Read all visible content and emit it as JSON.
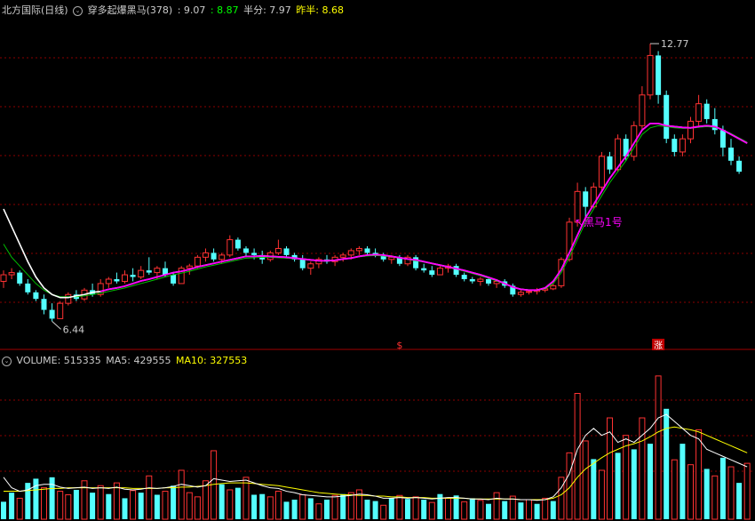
{
  "header": {
    "stock": "北方国际(日线)",
    "indicator_name": "穿多起爆黑马(378)",
    "value1": ": 9.07",
    "value2": ": 8.87",
    "half_label": "半分: 7.97",
    "prev_half_label": "昨半: 8.68"
  },
  "volume_header": {
    "volume": "VOLUME: 515335",
    "ma5": "MA5: 429555",
    "ma10": "MA10: 327553"
  },
  "colors": {
    "up": "#ff3232",
    "down": "#54ffff",
    "magenta": "#ff00ff",
    "white_line": "#ffffff",
    "green_line": "#00c000",
    "yellow": "#ffff00",
    "grid": "#8b0000",
    "header_green": "#00ff00"
  },
  "chart_data": {
    "type": "candlestick",
    "price_range": [
      5.9,
      13.4
    ],
    "volume_max": 215000,
    "annotations": {
      "high": "12.77",
      "low": "6.44",
      "signal": "黑马1号",
      "marker1": "$",
      "marker2": "涨"
    },
    "candles": [
      [
        7.35,
        7.6,
        7.2,
        7.5
      ],
      [
        7.5,
        7.65,
        7.4,
        7.55
      ],
      [
        7.55,
        7.6,
        7.25,
        7.3
      ],
      [
        7.3,
        7.4,
        7.05,
        7.1
      ],
      [
        7.1,
        7.15,
        6.9,
        6.95
      ],
      [
        6.95,
        7.05,
        6.6,
        6.7
      ],
      [
        6.7,
        6.85,
        6.44,
        6.5
      ],
      [
        6.5,
        6.9,
        6.5,
        6.85
      ],
      [
        6.85,
        7.1,
        6.8,
        7.05
      ],
      [
        7.05,
        7.15,
        6.9,
        6.95
      ],
      [
        6.95,
        7.2,
        6.9,
        7.15
      ],
      [
        7.15,
        7.3,
        7.0,
        7.05
      ],
      [
        7.05,
        7.4,
        7.0,
        7.3
      ],
      [
        7.3,
        7.45,
        7.2,
        7.4
      ],
      [
        7.4,
        7.55,
        7.3,
        7.35
      ],
      [
        7.35,
        7.6,
        7.3,
        7.5
      ],
      [
        7.5,
        7.65,
        7.35,
        7.45
      ],
      [
        7.45,
        7.7,
        7.4,
        7.6
      ],
      [
        7.6,
        7.9,
        7.5,
        7.55
      ],
      [
        7.55,
        7.7,
        7.4,
        7.65
      ],
      [
        7.65,
        7.8,
        7.45,
        7.5
      ],
      [
        7.5,
        7.55,
        7.25,
        7.3
      ],
      [
        7.3,
        7.7,
        7.3,
        7.65
      ],
      [
        7.65,
        7.75,
        7.5,
        7.7
      ],
      [
        7.7,
        7.95,
        7.65,
        7.9
      ],
      [
        7.9,
        8.1,
        7.8,
        8.0
      ],
      [
        8.0,
        8.1,
        7.8,
        7.85
      ],
      [
        7.85,
        8.0,
        7.75,
        7.95
      ],
      [
        7.95,
        8.4,
        7.9,
        8.3
      ],
      [
        8.3,
        8.35,
        8.05,
        8.1
      ],
      [
        8.1,
        8.15,
        7.9,
        8.0
      ],
      [
        8.0,
        8.1,
        7.85,
        7.95
      ],
      [
        7.95,
        8.05,
        7.75,
        7.85
      ],
      [
        7.85,
        8.05,
        7.8,
        8.0
      ],
      [
        8.0,
        8.3,
        7.95,
        8.1
      ],
      [
        8.1,
        8.15,
        7.9,
        7.95
      ],
      [
        7.95,
        8.0,
        7.8,
        7.85
      ],
      [
        7.85,
        7.95,
        7.6,
        7.65
      ],
      [
        7.65,
        7.8,
        7.5,
        7.75
      ],
      [
        7.75,
        7.9,
        7.65,
        7.85
      ],
      [
        7.85,
        7.95,
        7.75,
        7.8
      ],
      [
        7.8,
        7.95,
        7.7,
        7.9
      ],
      [
        7.9,
        8.0,
        7.8,
        7.95
      ],
      [
        7.95,
        8.1,
        7.85,
        8.05
      ],
      [
        8.05,
        8.15,
        7.95,
        8.1
      ],
      [
        8.1,
        8.15,
        7.95,
        8.0
      ],
      [
        8.0,
        8.1,
        7.9,
        7.95
      ],
      [
        7.95,
        8.0,
        7.8,
        7.85
      ],
      [
        7.85,
        7.95,
        7.75,
        7.9
      ],
      [
        7.9,
        7.95,
        7.7,
        7.75
      ],
      [
        7.75,
        7.95,
        7.7,
        7.9
      ],
      [
        7.9,
        7.95,
        7.6,
        7.65
      ],
      [
        7.65,
        7.75,
        7.55,
        7.6
      ],
      [
        7.6,
        7.7,
        7.45,
        7.5
      ],
      [
        7.5,
        7.7,
        7.5,
        7.65
      ],
      [
        7.65,
        7.75,
        7.55,
        7.7
      ],
      [
        7.7,
        7.75,
        7.45,
        7.5
      ],
      [
        7.5,
        7.55,
        7.35,
        7.4
      ],
      [
        7.4,
        7.45,
        7.3,
        7.35
      ],
      [
        7.35,
        7.45,
        7.25,
        7.4
      ],
      [
        7.4,
        7.45,
        7.25,
        7.3
      ],
      [
        7.3,
        7.4,
        7.2,
        7.35
      ],
      [
        7.35,
        7.4,
        7.2,
        7.25
      ],
      [
        7.25,
        7.3,
        7.0,
        7.05
      ],
      [
        7.05,
        7.15,
        7.0,
        7.1
      ],
      [
        7.1,
        7.15,
        7.05,
        7.12
      ],
      [
        7.12,
        7.2,
        7.05,
        7.15
      ],
      [
        7.15,
        7.2,
        7.1,
        7.18
      ],
      [
        7.18,
        7.3,
        7.15,
        7.25
      ],
      [
        7.25,
        7.9,
        7.2,
        7.85
      ],
      [
        7.85,
        8.8,
        7.8,
        8.7
      ],
      [
        8.7,
        9.6,
        8.6,
        9.4
      ],
      [
        9.4,
        9.5,
        8.8,
        9.05
      ],
      [
        9.05,
        9.6,
        9.0,
        9.5
      ],
      [
        9.5,
        10.3,
        9.4,
        10.2
      ],
      [
        10.2,
        10.3,
        9.8,
        9.9
      ],
      [
        9.9,
        10.7,
        9.85,
        10.6
      ],
      [
        10.6,
        10.7,
        10.1,
        10.2
      ],
      [
        10.2,
        11.0,
        10.1,
        10.9
      ],
      [
        10.9,
        11.8,
        10.8,
        11.6
      ],
      [
        11.6,
        12.77,
        11.5,
        12.5
      ],
      [
        12.5,
        12.6,
        11.4,
        11.6
      ],
      [
        11.6,
        11.7,
        10.5,
        10.6
      ],
      [
        10.6,
        10.7,
        10.2,
        10.3
      ],
      [
        10.3,
        10.7,
        10.2,
        10.6
      ],
      [
        10.6,
        11.1,
        10.5,
        11.0
      ],
      [
        11.0,
        11.6,
        10.9,
        11.4
      ],
      [
        11.4,
        11.5,
        10.95,
        11.05
      ],
      [
        11.05,
        11.3,
        10.7,
        10.8
      ],
      [
        10.8,
        10.9,
        10.2,
        10.4
      ],
      [
        10.4,
        10.6,
        10.0,
        10.1
      ],
      [
        10.1,
        10.2,
        9.8,
        9.85
      ]
    ],
    "volumes": [
      [
        25000,
        false
      ],
      [
        38000,
        false
      ],
      [
        30000,
        true
      ],
      [
        52000,
        false
      ],
      [
        58000,
        false
      ],
      [
        45000,
        true
      ],
      [
        60000,
        false
      ],
      [
        40000,
        true
      ],
      [
        35000,
        true
      ],
      [
        42000,
        false
      ],
      [
        55000,
        true
      ],
      [
        38000,
        false
      ],
      [
        48000,
        true
      ],
      [
        36000,
        false
      ],
      [
        52000,
        true
      ],
      [
        30000,
        false
      ],
      [
        41000,
        true
      ],
      [
        38000,
        false
      ],
      [
        62000,
        true
      ],
      [
        35000,
        false
      ],
      [
        40000,
        true
      ],
      [
        48000,
        false
      ],
      [
        70000,
        true
      ],
      [
        38000,
        true
      ],
      [
        32000,
        true
      ],
      [
        55000,
        true
      ],
      [
        98000,
        true
      ],
      [
        50000,
        false
      ],
      [
        42000,
        true
      ],
      [
        45000,
        false
      ],
      [
        60000,
        true
      ],
      [
        35000,
        false
      ],
      [
        36000,
        false
      ],
      [
        32000,
        true
      ],
      [
        40000,
        true
      ],
      [
        25000,
        false
      ],
      [
        28000,
        false
      ],
      [
        35000,
        true
      ],
      [
        30000,
        false
      ],
      [
        22000,
        true
      ],
      [
        28000,
        false
      ],
      [
        34000,
        true
      ],
      [
        36000,
        false
      ],
      [
        38000,
        true
      ],
      [
        42000,
        true
      ],
      [
        28000,
        false
      ],
      [
        26000,
        false
      ],
      [
        20000,
        true
      ],
      [
        30000,
        false
      ],
      [
        34000,
        true
      ],
      [
        29000,
        false
      ],
      [
        32000,
        true
      ],
      [
        28000,
        false
      ],
      [
        24000,
        true
      ],
      [
        36000,
        false
      ],
      [
        30000,
        true
      ],
      [
        34000,
        false
      ],
      [
        25000,
        true
      ],
      [
        30000,
        false
      ],
      [
        27000,
        true
      ],
      [
        22000,
        false
      ],
      [
        38000,
        true
      ],
      [
        26000,
        false
      ],
      [
        33000,
        true
      ],
      [
        24000,
        false
      ],
      [
        28000,
        true
      ],
      [
        22000,
        false
      ],
      [
        30000,
        true
      ],
      [
        26000,
        false
      ],
      [
        60000,
        true
      ],
      [
        95000,
        true
      ],
      [
        180000,
        true
      ],
      [
        112000,
        true
      ],
      [
        86000,
        false
      ],
      [
        70000,
        true
      ],
      [
        145000,
        true
      ],
      [
        95000,
        false
      ],
      [
        120000,
        true
      ],
      [
        100000,
        false
      ],
      [
        145000,
        true
      ],
      [
        108000,
        false
      ],
      [
        205000,
        true
      ],
      [
        158000,
        false
      ],
      [
        85000,
        true
      ],
      [
        108000,
        false
      ],
      [
        78000,
        true
      ],
      [
        128000,
        true
      ],
      [
        72000,
        false
      ],
      [
        62000,
        true
      ],
      [
        88000,
        false
      ],
      [
        75000,
        true
      ],
      [
        52000,
        false
      ],
      [
        80000,
        true
      ]
    ],
    "ma_white": [
      9.0,
      8.6,
      8.2,
      7.8,
      7.45,
      7.2,
      7.05,
      6.98,
      6.98,
      7.02,
      7.05,
      7.1,
      7.12,
      7.17,
      7.2,
      7.24,
      7.3,
      7.36,
      7.4,
      7.45,
      7.5,
      7.55,
      7.58,
      7.62,
      7.68,
      7.72,
      7.76,
      7.8,
      7.84,
      7.88,
      7.92,
      7.92,
      7.93,
      7.92,
      7.91,
      7.9,
      7.88,
      7.86,
      7.84,
      7.82,
      7.82,
      7.83,
      7.86,
      7.88,
      7.92,
      7.95,
      7.96,
      7.95,
      7.92,
      7.89,
      7.86,
      7.84,
      7.8,
      7.76,
      7.72,
      7.68,
      7.64,
      7.6,
      7.55,
      7.5,
      7.44,
      7.38,
      7.3,
      7.22,
      7.17,
      7.15,
      7.15,
      7.2,
      7.35,
      7.62,
      8.0,
      8.4,
      8.8,
      9.1,
      9.4,
      9.7,
      9.95,
      10.2,
      10.5,
      10.8,
      10.95,
      10.95,
      10.9,
      10.88,
      10.86,
      10.85,
      10.88,
      10.9,
      10.88,
      10.8,
      10.7,
      10.6,
      10.5
    ],
    "ma_green": [
      8.2,
      7.9,
      7.7,
      7.5,
      7.3,
      7.15,
      7.05,
      7.0,
      7.0,
      7.0,
      7.02,
      7.05,
      7.08,
      7.12,
      7.16,
      7.2,
      7.25,
      7.3,
      7.35,
      7.4,
      7.45,
      7.5,
      7.54,
      7.58,
      7.63,
      7.68,
      7.72,
      7.76,
      7.8,
      7.84,
      7.88,
      7.89,
      7.9,
      7.9,
      7.89,
      7.88,
      7.87,
      7.85,
      7.83,
      7.82,
      7.82,
      7.83,
      7.85,
      7.88,
      7.91,
      7.93,
      7.94,
      7.93,
      7.91,
      7.88,
      7.85,
      7.82,
      7.79,
      7.75,
      7.71,
      7.67,
      7.63,
      7.58,
      7.53,
      7.48,
      7.42,
      7.36,
      7.29,
      7.22,
      7.17,
      7.15,
      7.15,
      7.18,
      7.3,
      7.55,
      7.9,
      8.3,
      8.7,
      9.0,
      9.3,
      9.6,
      9.85,
      10.1,
      10.4,
      10.7,
      10.85,
      10.9,
      10.88,
      10.85,
      10.84,
      10.84,
      10.86,
      10.88,
      10.86,
      10.8,
      10.72,
      10.62,
      10.52
    ],
    "ma_magenta_from": 12,
    "vol_ma_white": [
      60000,
      45000,
      40000,
      42000,
      48000,
      50000,
      50000,
      46000,
      44000,
      45000,
      46000,
      44000,
      45000,
      44000,
      46000,
      43000,
      42000,
      43000,
      45000,
      44000,
      45000,
      47000,
      50000,
      48000,
      46000,
      48000,
      58000,
      56000,
      54000,
      55000,
      56000,
      52000,
      48000,
      45000,
      44000,
      40000,
      38000,
      35000,
      34000,
      33000,
      32000,
      32000,
      33000,
      34000,
      36000,
      35000,
      33000,
      30000,
      30000,
      31000,
      30000,
      31000,
      30000,
      29000,
      30000,
      31000,
      31000,
      30000,
      29000,
      29000,
      28000,
      30000,
      29000,
      29000,
      28000,
      28000,
      27000,
      28000,
      32000,
      45000,
      65000,
      100000,
      120000,
      130000,
      120000,
      125000,
      110000,
      115000,
      110000,
      120000,
      130000,
      145000,
      150000,
      140000,
      130000,
      120000,
      115000,
      100000,
      95000,
      90000,
      85000,
      80000,
      75000
    ],
    "vol_ma_yellow": [
      40000,
      40000,
      40000,
      41000,
      42000,
      43000,
      44000,
      44000,
      45000,
      45000,
      45000,
      45000,
      45000,
      45000,
      45000,
      45000,
      44000,
      44000,
      44000,
      44000,
      45000,
      45000,
      46000,
      46000,
      47000,
      48000,
      50000,
      51000,
      52000,
      52000,
      52000,
      51000,
      50000,
      49000,
      48000,
      46000,
      44000,
      42000,
      40000,
      38000,
      37000,
      36000,
      35000,
      35000,
      34000,
      34000,
      33000,
      33000,
      32000,
      32000,
      31000,
      31000,
      31000,
      30000,
      30000,
      30000,
      30000,
      30000,
      29000,
      29000,
      29000,
      29000,
      29000,
      29000,
      28000,
      28000,
      28000,
      28000,
      30000,
      35000,
      45000,
      60000,
      72000,
      80000,
      88000,
      95000,
      100000,
      105000,
      108000,
      112000,
      118000,
      125000,
      130000,
      132000,
      130000,
      128000,
      125000,
      120000,
      115000,
      110000,
      105000,
      100000,
      95000
    ]
  }
}
